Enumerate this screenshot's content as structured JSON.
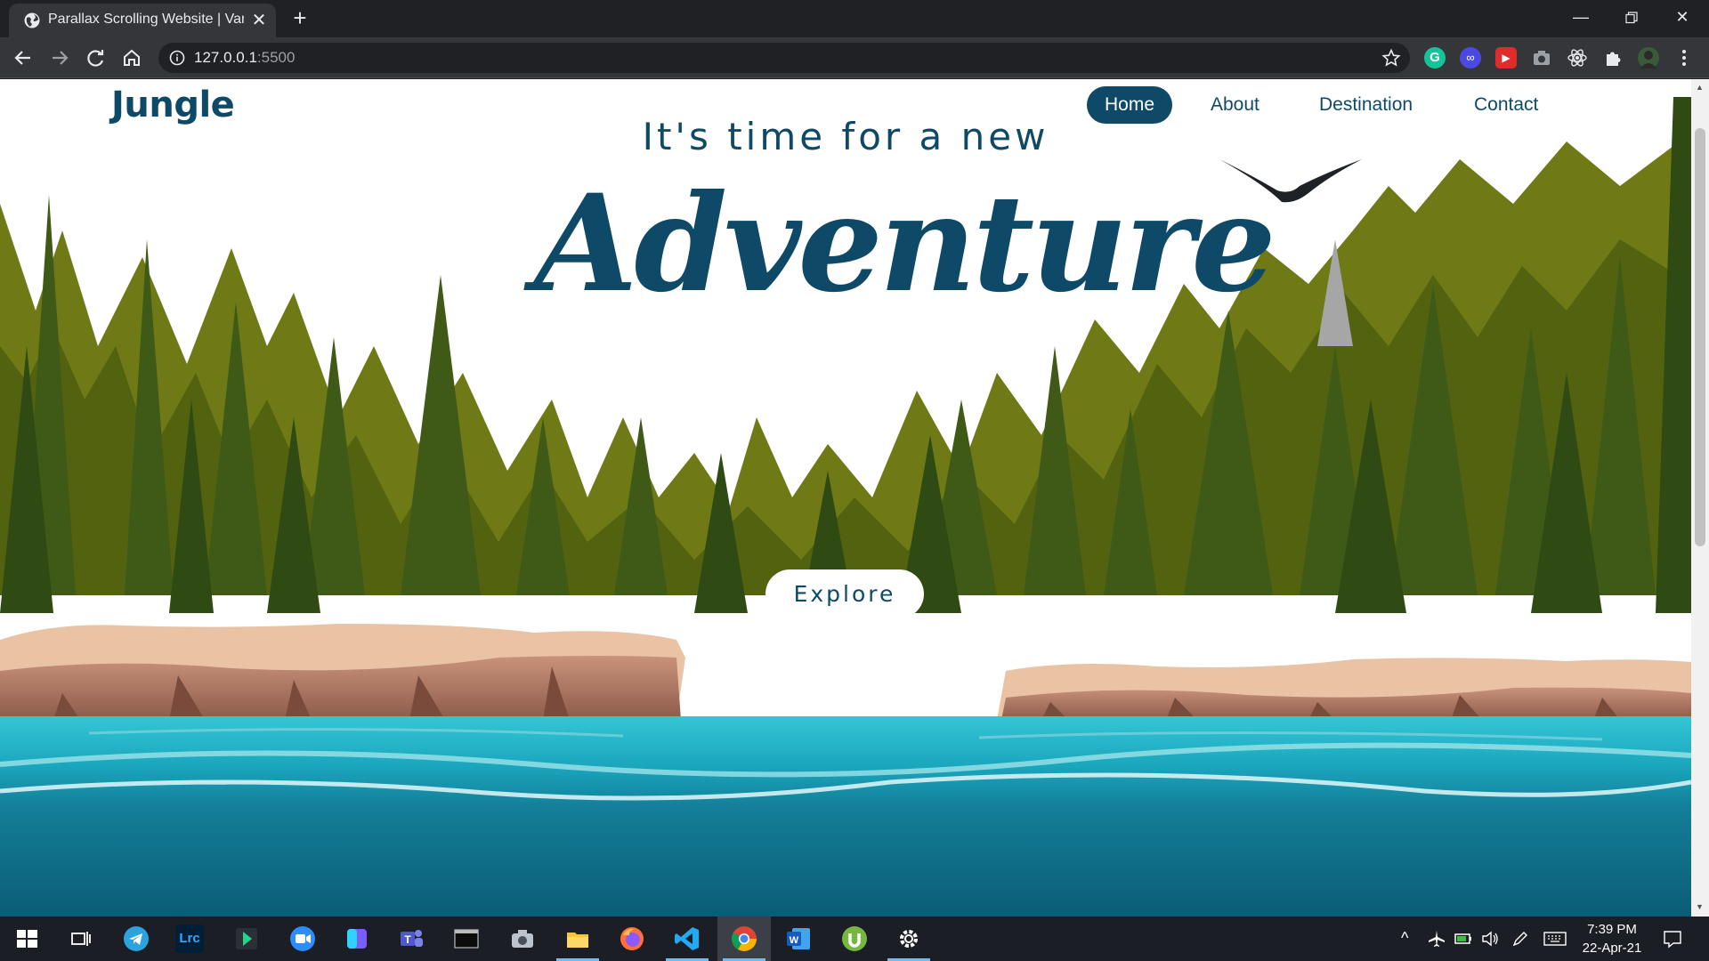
{
  "browser": {
    "tab_title": "Parallax Scrolling Website | Vanill",
    "url_host": "127.0.0.1",
    "url_port": ":5500"
  },
  "page": {
    "logo": "Jungle",
    "nav": [
      "Home",
      "About",
      "Destination",
      "Contact"
    ],
    "active_nav": "Home",
    "subtitle": "It's time for a new",
    "headline": "Adventure",
    "cta": "Explore"
  },
  "taskbar": {
    "apps": [
      "start-icon",
      "task-view-icon",
      "telegram-icon",
      "lightroom-icon",
      "app-icon",
      "zoom-icon",
      "app-icon",
      "teams-icon",
      "terminal-icon",
      "camera-icon",
      "file-explorer-icon",
      "firefox-icon",
      "vscode-icon",
      "chrome-icon",
      "word-icon",
      "utorrent-icon",
      "settings-icon"
    ],
    "lightroom_label": "Lrc",
    "time": "7:39 PM",
    "date": "22-Apr-21"
  },
  "colors": {
    "brand": "#0e4a68",
    "chrome_dark": "#202124",
    "chrome_toolbar": "#35363a",
    "taskbar": "#1b1e24",
    "water": "#0f7a92",
    "forest": "#5a6616"
  }
}
